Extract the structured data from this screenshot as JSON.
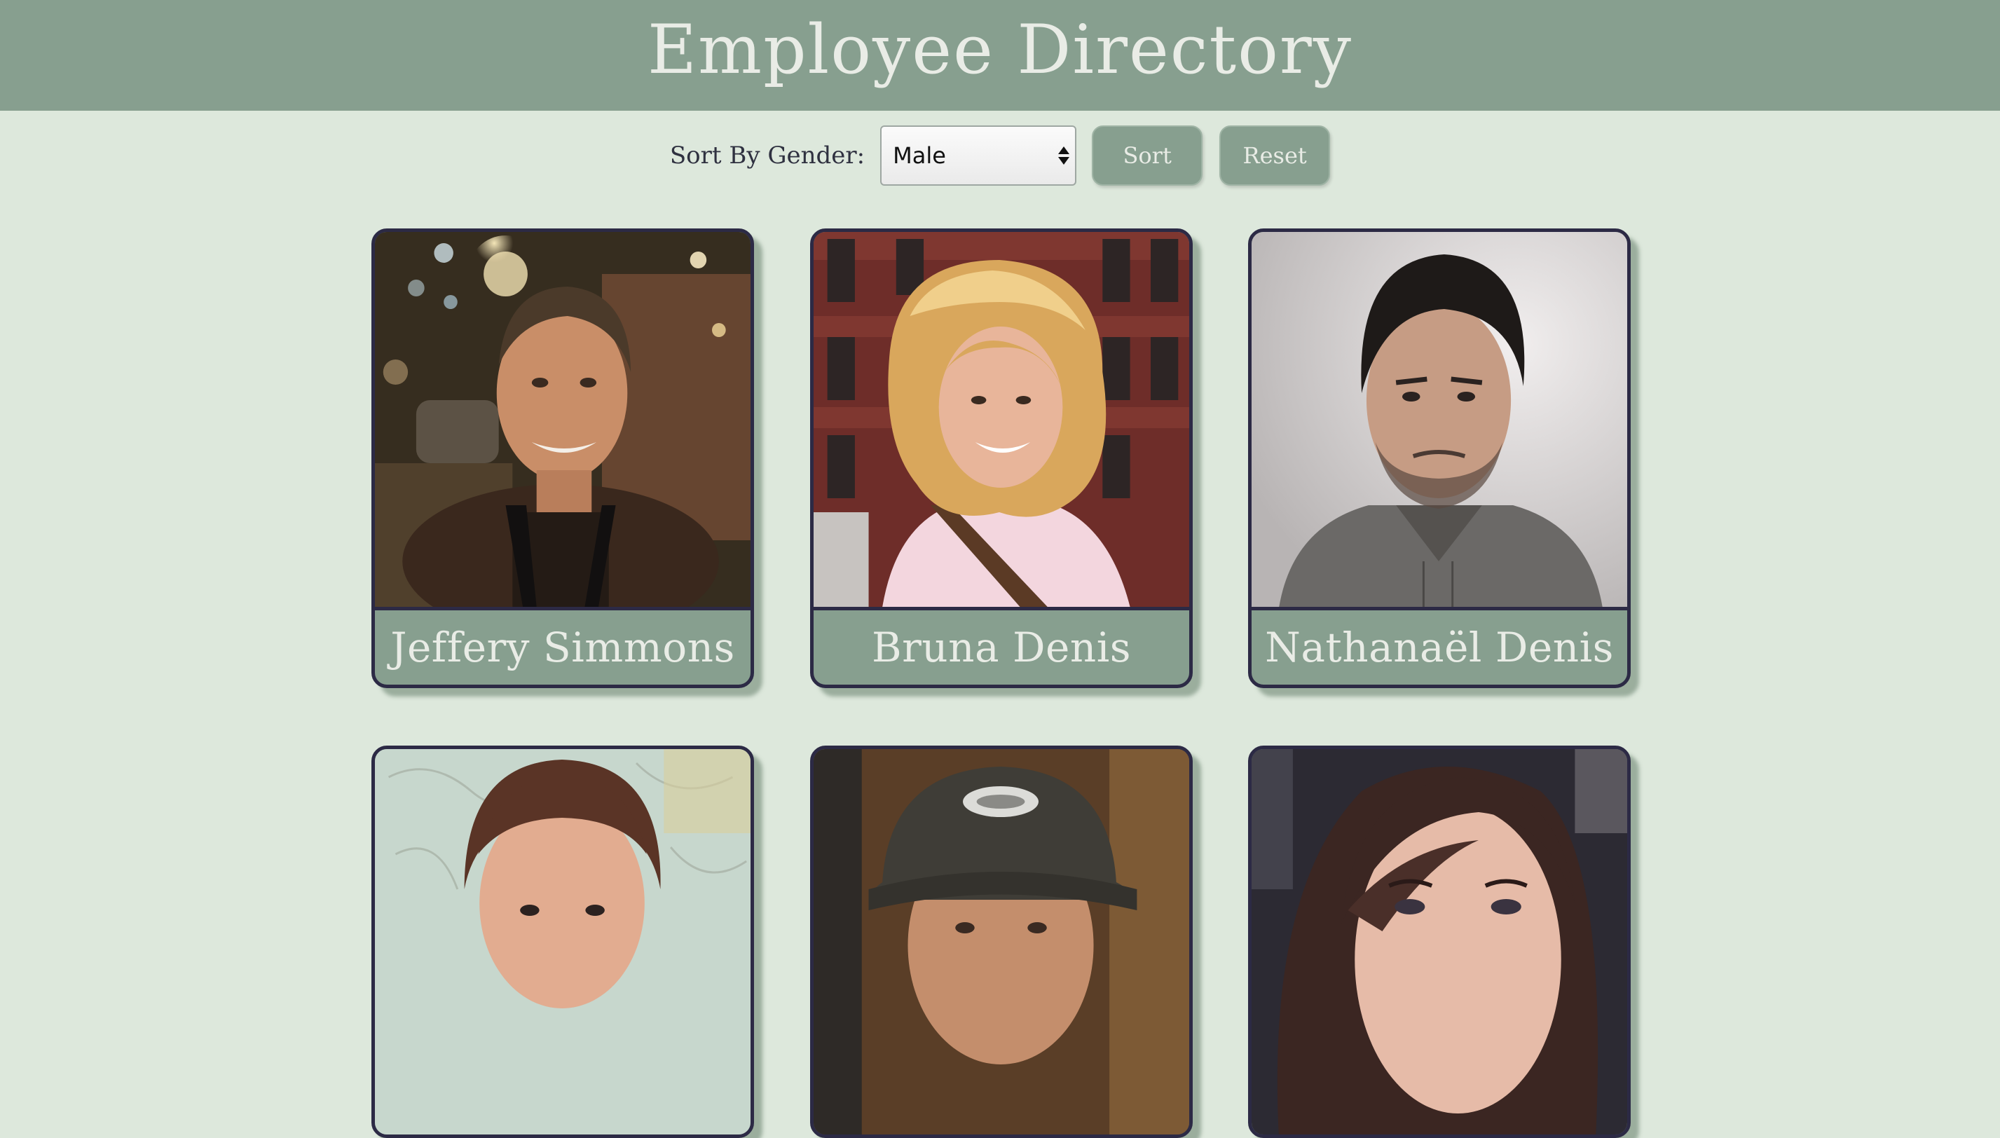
{
  "header": {
    "title": "Employee Directory"
  },
  "controls": {
    "sort_label": "Sort By Gender:",
    "gender_select_value": "Male",
    "sort_button": "Sort",
    "reset_button": "Reset"
  },
  "employees": [
    {
      "name": "Jeffery Simmons"
    },
    {
      "name": "Bruna Denis"
    },
    {
      "name": "Nathanaël Denis"
    },
    {
      "name": ""
    },
    {
      "name": ""
    },
    {
      "name": ""
    }
  ],
  "colors": {
    "page_background": "#dde8dc",
    "accent": "#879f8f",
    "card_border": "#2c2a45",
    "light_text": "#e9ece6"
  }
}
